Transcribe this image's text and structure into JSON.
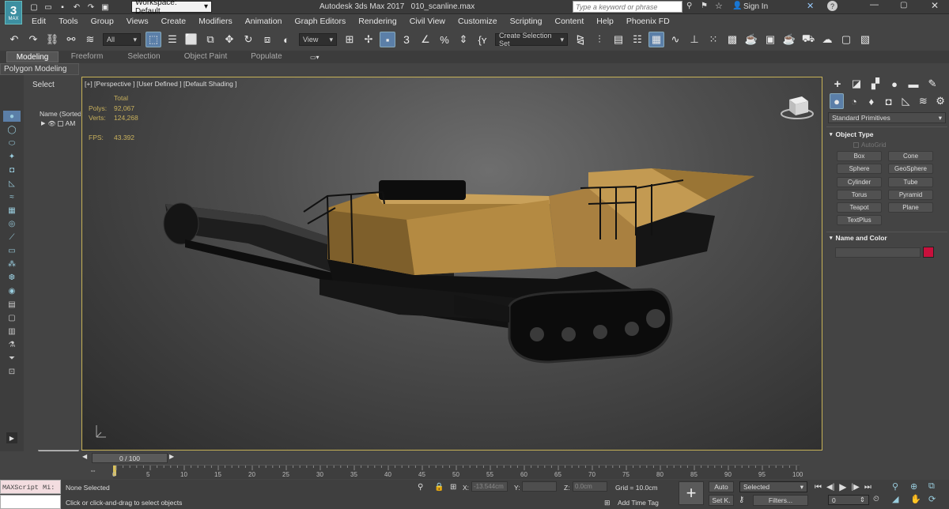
{
  "titlebar": {
    "workspace": "Workspace: Default",
    "app": "Autodesk 3ds Max 2017",
    "file": "010_scanline.max",
    "search_placeholder": "Type a keyword or phrase",
    "signin": "Sign In",
    "logo": "3",
    "logo_sub": "MAX"
  },
  "menu": [
    "Edit",
    "Tools",
    "Group",
    "Views",
    "Create",
    "Modifiers",
    "Animation",
    "Graph Editors",
    "Rendering",
    "Civil View",
    "Customize",
    "Scripting",
    "Content",
    "Help",
    "Phoenix FD"
  ],
  "toolbar": {
    "filter": "All",
    "ref_coord": "View",
    "selection_set": "Create Selection Set"
  },
  "ribbon": {
    "tabs": [
      "Modeling",
      "Freeform",
      "Selection",
      "Object Paint",
      "Populate"
    ],
    "subtab": "Polygon Modeling"
  },
  "scene": {
    "tab": "Select",
    "header": "Name (Sorted",
    "item": "AM"
  },
  "viewport": {
    "label": "[+] [Perspective ] [User Defined ] [Default Shading ]",
    "stats_header": "Total",
    "polys_label": "Polys:",
    "polys": "92,067",
    "verts_label": "Verts:",
    "verts": "124,268",
    "fps_label": "FPS:",
    "fps": "43.392"
  },
  "command_panel": {
    "dropdown": "Standard Primitives",
    "object_type": "Object Type",
    "autogrid": "AutoGrid",
    "primitives": [
      "Box",
      "Cone",
      "Sphere",
      "GeoSphere",
      "Cylinder",
      "Tube",
      "Torus",
      "Pyramid",
      "Teapot",
      "Plane",
      "TextPlus"
    ],
    "name_color": "Name and Color",
    "color": "#c8103c"
  },
  "timeline": {
    "frame": "0 / 100",
    "ticks": [
      "0",
      "5",
      "10",
      "15",
      "20",
      "25",
      "30",
      "35",
      "40",
      "45",
      "50",
      "55",
      "60",
      "65",
      "70",
      "75",
      "80",
      "85",
      "90",
      "95",
      "100"
    ]
  },
  "status": {
    "maxscript": "MAXScript Mi:",
    "selection": "None Selected",
    "prompt": "Click or click-and-drag to select objects",
    "x_label": "X:",
    "x": "-13.544cm",
    "y_label": "Y:",
    "y": "",
    "z_label": "Z:",
    "z": "0.0cm",
    "grid": "Grid = 10.0cm",
    "auto": "Auto",
    "selected": "Selected",
    "setkey": "Set K.",
    "filters": "Filters...",
    "frame": "0",
    "add_time_tag": "Add Time Tag"
  }
}
